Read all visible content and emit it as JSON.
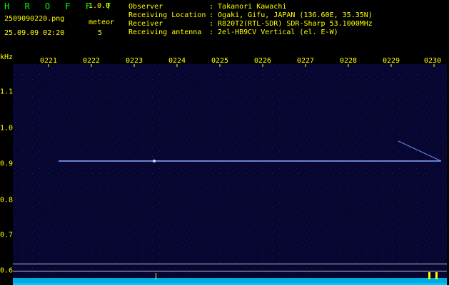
{
  "header": {
    "app_title": "H R O F F T",
    "app_version": "1.0.0",
    "file_name": "2509090220.png",
    "meteor_label": "meteor",
    "date_time": "25.09.09 02:20",
    "meteor_count": "5"
  },
  "info": [
    {
      "key": "Observer",
      "value": ": Takanori Kawachi"
    },
    {
      "key": "Receiving Location",
      "value": ": Ogaki, Gifu, JAPAN (136.60E, 35.35N)"
    },
    {
      "key": "Receiver",
      "value": ": R820T2(RTL-SDR) SDR-Sharp 53.1000MHz"
    },
    {
      "key": "Receiving antenna",
      "value": ": 2el-HB9CV Vertical (el. E-W)"
    }
  ],
  "axes": {
    "y_unit": "kHz",
    "y_ticks": [
      "1.1",
      "1.0",
      "0.9",
      "0.8",
      "0.7",
      "0.6"
    ],
    "x_ticks": [
      "0221",
      "0222",
      "0223",
      "0224",
      "0225",
      "0226",
      "0227",
      "0228",
      "0229",
      "0230"
    ]
  },
  "colors": {
    "background": "#060630",
    "text_accent": "#ffff00",
    "title": "#00ff00",
    "signal": "#88aaff"
  }
}
